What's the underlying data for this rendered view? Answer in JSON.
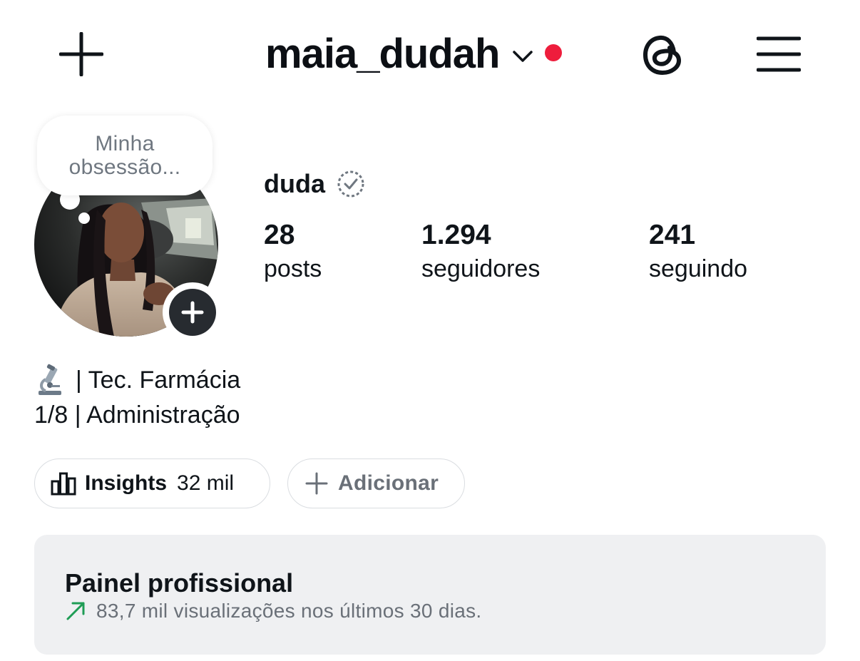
{
  "header": {
    "username": "maia_dudah",
    "accent_dot_color": "#ee1d3c"
  },
  "note": {
    "text": "Minha obsessão..."
  },
  "profile": {
    "display_name": "duda",
    "stats": [
      {
        "value": "28",
        "label": "posts"
      },
      {
        "value": "1.294",
        "label": "seguidores"
      },
      {
        "value": "241",
        "label": "seguindo"
      }
    ],
    "bio": {
      "line1_emoji": "microscope-icon",
      "line1_text": "| Tec. Farmácia",
      "line2_text": "1/8 | Administração"
    }
  },
  "actions": {
    "insights_label": "Insights",
    "insights_count": "32 mil",
    "add_label": "Adicionar"
  },
  "professional_dashboard": {
    "title": "Painel profissional",
    "subtitle": "83,7 mil visualizações nos últimos 30 dias.",
    "trend_color": "#1f9d55"
  }
}
